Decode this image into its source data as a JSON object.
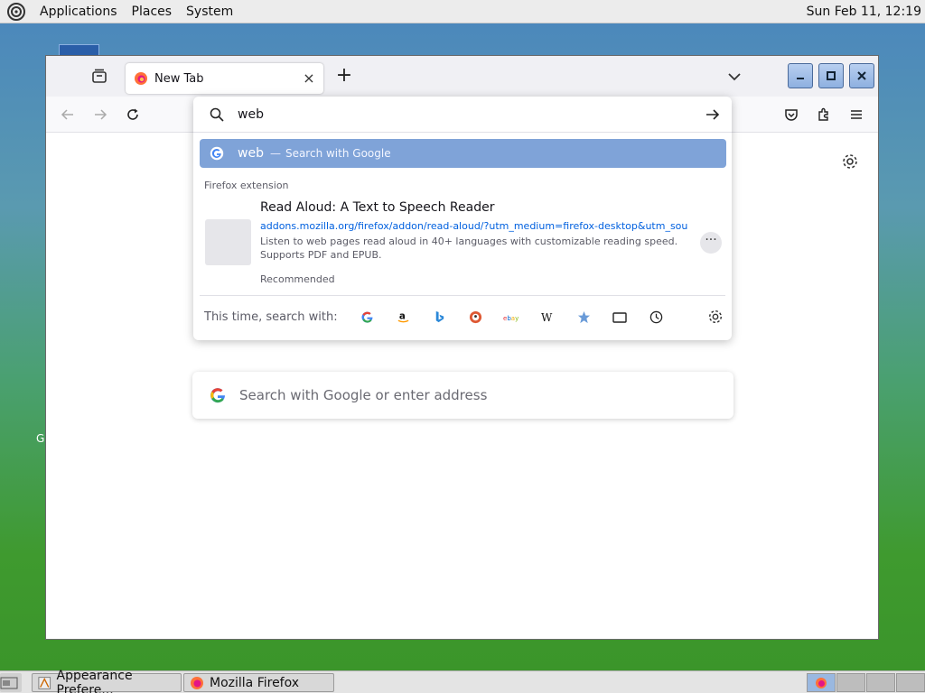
{
  "top_panel": {
    "menus": [
      "Applications",
      "Places",
      "System"
    ],
    "clock": "Sun Feb 11, 12:19"
  },
  "desktop": {
    "stray_letter": "G"
  },
  "browser": {
    "tab": {
      "title": "New Tab"
    },
    "urlbar": {
      "typed": "web",
      "google_result": {
        "query": "web",
        "separator": "—",
        "action": "Search with Google"
      },
      "extension": {
        "group_label": "Firefox extension",
        "title": "Read Aloud: A Text to Speech Reader",
        "url": "addons.mozilla.org/firefox/addon/read-aloud/?utm_medium=firefox-desktop&utm_source=firefox-suggest",
        "description": "Listen to web pages read aloud in 40+ languages with customizable reading speed. Supports PDF and EPUB.",
        "tag": "Recommended",
        "more": "···"
      },
      "one_off": {
        "label": "This time, search with:",
        "engines": [
          "Google",
          "Amazon",
          "Bing",
          "DuckDuckGo",
          "eBay",
          "Wikipedia",
          "Bookmarks",
          "Tabs",
          "History"
        ]
      }
    },
    "content": {
      "search_placeholder": "Search with Google or enter address"
    }
  },
  "taskbar": {
    "tasks": [
      "Appearance Prefere...",
      "Mozilla Firefox"
    ]
  },
  "colors": {
    "accent": "#7fa3d8",
    "link": "#0060df"
  }
}
